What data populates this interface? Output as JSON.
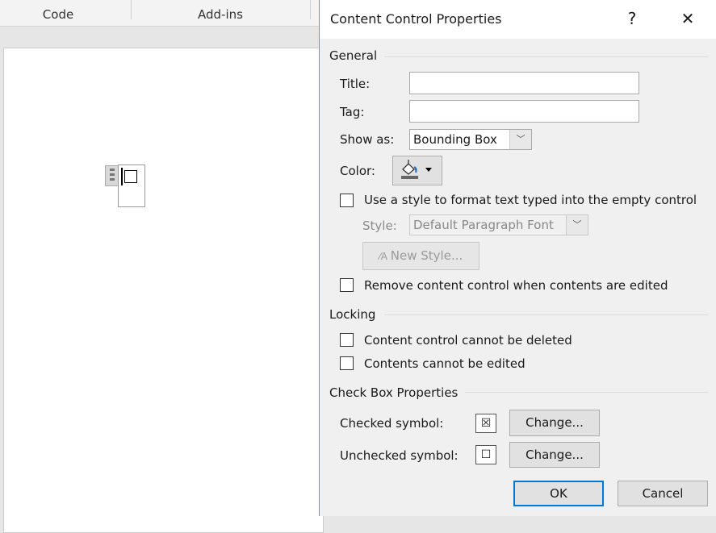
{
  "ribbon": {
    "tabs": [
      {
        "label": "Code"
      },
      {
        "label": "Add-ins"
      }
    ]
  },
  "dialog": {
    "title": "Content Control Properties",
    "help_label": "?",
    "close_label": "✕",
    "general": {
      "heading": "General",
      "title_label": "Title:",
      "title_value": "",
      "tag_label": "Tag:",
      "tag_value": "",
      "show_as_label": "Show as:",
      "show_as_value": "Bounding Box",
      "color_label": "Color:",
      "use_style_label": "Use a style to format text typed into the empty control",
      "use_style_checked": false,
      "style_label": "Style:",
      "style_value": "Default Paragraph Font",
      "new_style_label": "New Style...",
      "remove_label": "Remove content control when contents are edited",
      "remove_checked": false
    },
    "locking": {
      "heading": "Locking",
      "cannot_delete_label": "Content control cannot be deleted",
      "cannot_delete_checked": false,
      "cannot_edit_label": "Contents cannot be edited",
      "cannot_edit_checked": false
    },
    "checkbox_props": {
      "heading": "Check Box Properties",
      "checked_label": "Checked symbol:",
      "checked_symbol": "☒",
      "unchecked_label": "Unchecked symbol:",
      "unchecked_symbol": "☐",
      "change_label": "Change..."
    },
    "ok_label": "OK",
    "cancel_label": "Cancel"
  },
  "colors": {
    "accent": "#0078d7",
    "dialog_bg": "#f0f0f0"
  }
}
